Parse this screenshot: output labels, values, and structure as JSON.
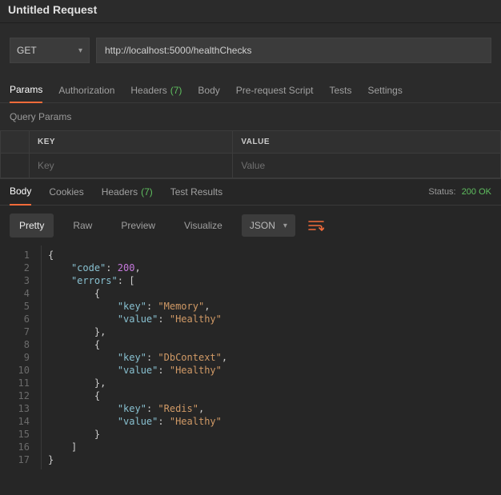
{
  "title": "Untitled Request",
  "request": {
    "method": "GET",
    "url": "http://localhost:5000/healthChecks"
  },
  "tabs": {
    "params": "Params",
    "authorization": "Authorization",
    "headers": "Headers",
    "headers_count": "(7)",
    "body": "Body",
    "prerequest": "Pre-request Script",
    "tests": "Tests",
    "settings": "Settings"
  },
  "query_params_label": "Query Params",
  "kv": {
    "key_header": "KEY",
    "value_header": "VALUE",
    "key_placeholder": "Key",
    "value_placeholder": "Value"
  },
  "response": {
    "tabs": {
      "body": "Body",
      "cookies": "Cookies",
      "headers": "Headers",
      "headers_count": "(7)",
      "test_results": "Test Results"
    },
    "status_label": "Status:",
    "status_value": "200 OK",
    "toolbar": {
      "pretty": "Pretty",
      "raw": "Raw",
      "preview": "Preview",
      "visualize": "Visualize",
      "format": "JSON"
    }
  },
  "code_lines": [
    "{",
    "    \"code\": 200,",
    "    \"errors\": [",
    "        {",
    "            \"key\": \"Memory\",",
    "            \"value\": \"Healthy\"",
    "        },",
    "        {",
    "            \"key\": \"DbContext\",",
    "            \"value\": \"Healthy\"",
    "        },",
    "        {",
    "            \"key\": \"Redis\",",
    "            \"value\": \"Healthy\"",
    "        }",
    "    ]",
    "}"
  ],
  "chart_data": {
    "type": "table",
    "response_json": {
      "code": 200,
      "errors": [
        {
          "key": "Memory",
          "value": "Healthy"
        },
        {
          "key": "DbContext",
          "value": "Healthy"
        },
        {
          "key": "Redis",
          "value": "Healthy"
        }
      ]
    }
  }
}
